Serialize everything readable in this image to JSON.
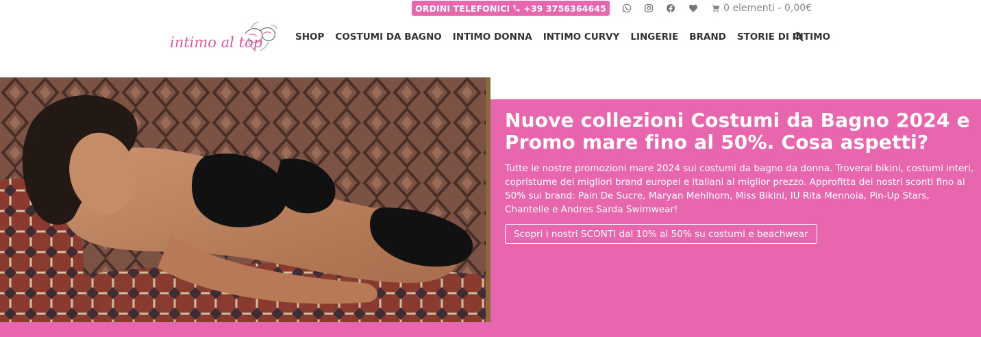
{
  "topbar": {
    "order_label": "ORDINI TELEFONICI",
    "phone": "+39 3756364645",
    "cart_text": "0 elementi - 0,00€"
  },
  "social": [
    "whatsapp-icon",
    "instagram-icon",
    "facebook-icon",
    "heart-icon"
  ],
  "logo": {
    "text": "intimo al top"
  },
  "nav": {
    "items": [
      "SHOP",
      "COSTUMI DA BAGNO",
      "INTIMO DONNA",
      "INTIMO CURVY",
      "LINGERIE",
      "BRAND",
      "STORIE DI INTIMO"
    ]
  },
  "hero": {
    "title": "Nuove collezioni Costumi da Bagno 2024 e Promo mare fino al 50%. Cosa aspetti?",
    "text": "Tutte le nostre promozioni mare 2024 sui costumi da bagno da donna. Troverai bikini, costumi interi, copristume dei migliori brand europei e italiani al miglior prezzo. Approfitta dei nostri sconti fino al 50% sui brand: Pain De Sucre, Maryan Mehlhorn, Miss Bikini, IU Rita Mennoia, Pin-Up Stars, Chantelle e Andres Sarda Swimwear!",
    "button": "Scopri i nostri SCONTI dal 10% al 50% su costumi e beachwear"
  },
  "colors": {
    "accent": "#e866ae",
    "nav_text": "#333333",
    "cart_text": "#888888"
  }
}
